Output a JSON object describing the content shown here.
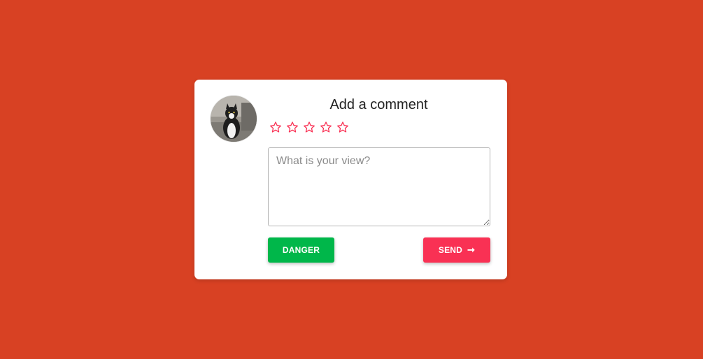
{
  "card": {
    "title": "Add a comment",
    "rating": {
      "max_stars": 5,
      "selected": 0,
      "star_color": "#f93154"
    },
    "comment": {
      "placeholder": "What is your view?",
      "value": ""
    },
    "buttons": {
      "danger_label": "DANGER",
      "send_label": "SEND",
      "send_icon": "arrow-right-icon"
    },
    "avatar": {
      "icon": "cat-avatar"
    }
  },
  "colors": {
    "background": "#d84123",
    "card": "#ffffff",
    "danger": "#00b74a",
    "send": "#f93154"
  }
}
